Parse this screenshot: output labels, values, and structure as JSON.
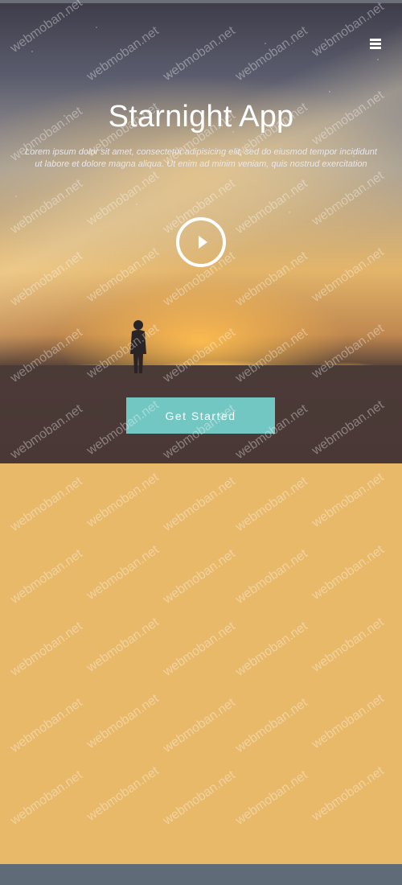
{
  "hero": {
    "title": "Starnight App",
    "subtitle": "Lorem ipsum dolor sit amet, consectetur adipisicing elit, sed do eiusmod tempor incididunt ut labore et dolore magna aliqua. Ut enim ad minim veniam, quis nostrud exercitation",
    "cta_label": "Get Started"
  },
  "icons": {
    "menu": "hamburger-menu-icon",
    "play": "play-icon"
  },
  "watermark": {
    "text": "webmoban.net"
  },
  "colors": {
    "cta_background": "#73c7c3",
    "content_background": "#e9b96a",
    "footer_background": "#5f6c77"
  }
}
